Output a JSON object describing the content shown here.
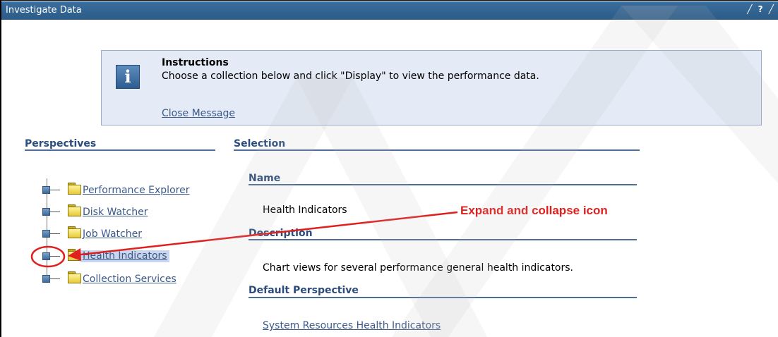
{
  "window": {
    "title": "Investigate Data",
    "titlebar_icons": [
      "╱",
      "?",
      "╱"
    ]
  },
  "instructions": {
    "icon": "info-icon",
    "title": "Instructions",
    "text": "Choose a collection below and click \"Display\" to view the performance data.",
    "close_link": "Close Message"
  },
  "perspectives": {
    "heading": "Perspectives",
    "items": [
      {
        "label": "Performance Explorer",
        "selected": false
      },
      {
        "label": "Disk Watcher",
        "selected": false
      },
      {
        "label": "Job Watcher",
        "selected": false
      },
      {
        "label": "Health Indicators",
        "selected": true
      },
      {
        "label": "Collection Services",
        "selected": false
      }
    ]
  },
  "selection": {
    "heading": "Selection",
    "name_label": "Name",
    "name_value": "Health Indicators",
    "description_label": "Description",
    "description_value": "Chart views for several performance general health indicators.",
    "default_perspective_label": "Default Perspective",
    "default_perspective_value": "System Resources Health Indicators"
  },
  "annotation": {
    "text": "Expand and collapse icon",
    "color": "#e0201e"
  },
  "colors": {
    "titlebar": "#2c5b86",
    "heading": "#2c4c7b",
    "link": "#3c5a8a",
    "selection_highlight": "#c9d6ee",
    "message_bg": "#e4ebf6"
  }
}
